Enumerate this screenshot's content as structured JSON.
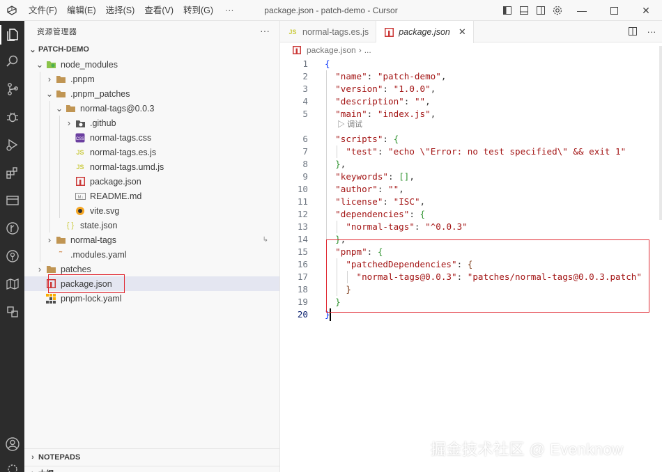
{
  "menu": [
    "文件(F)",
    "编辑(E)",
    "选择(S)",
    "查看(V)",
    "转到(G)"
  ],
  "menu_more": "···",
  "window_title": "package.json - patch-demo - Cursor",
  "sidebar": {
    "header": "资源管理器",
    "more": "···",
    "root": "PATCH-DEMO",
    "tree": [
      {
        "label": "node_modules",
        "depth": 0,
        "kind": "folder-node",
        "open": true
      },
      {
        "label": ".pnpm",
        "depth": 1,
        "kind": "folder",
        "open": false
      },
      {
        "label": ".pnpm_patches",
        "depth": 1,
        "kind": "folder",
        "open": true
      },
      {
        "label": "normal-tags@0.0.3",
        "depth": 2,
        "kind": "folder",
        "open": true
      },
      {
        "label": ".github",
        "depth": 3,
        "kind": "folder-github",
        "open": false
      },
      {
        "label": "normal-tags.css",
        "depth": 3,
        "kind": "css"
      },
      {
        "label": "normal-tags.es.js",
        "depth": 3,
        "kind": "js"
      },
      {
        "label": "normal-tags.umd.js",
        "depth": 3,
        "kind": "js"
      },
      {
        "label": "package.json",
        "depth": 3,
        "kind": "npm"
      },
      {
        "label": "README.md",
        "depth": 3,
        "kind": "md"
      },
      {
        "label": "vite.svg",
        "depth": 3,
        "kind": "svg"
      },
      {
        "label": "state.json",
        "depth": 2,
        "kind": "json"
      },
      {
        "label": "normal-tags",
        "depth": 1,
        "kind": "folder",
        "open": false,
        "badge": "↳"
      },
      {
        "label": ".modules.yaml",
        "depth": 1,
        "kind": "yaml"
      },
      {
        "label": "patches",
        "depth": 0,
        "kind": "folder",
        "open": false
      },
      {
        "label": "package.json",
        "depth": 0,
        "kind": "npm",
        "selected": true
      },
      {
        "label": "pnpm-lock.yaml",
        "depth": 0,
        "kind": "pnpm"
      }
    ],
    "notepads": "NOTEPADS",
    "outline": "大纲"
  },
  "tabs": [
    {
      "label": "normal-tags.es.js",
      "icon": "js",
      "active": false
    },
    {
      "label": "package.json",
      "icon": "npm",
      "active": true,
      "close": "✕"
    }
  ],
  "breadcrumb": {
    "file": "package.json",
    "sep": "›",
    "more": "..."
  },
  "codelens": "调试",
  "code_lines": [
    {
      "n": "1",
      "text": "{"
    },
    {
      "n": "2",
      "text": "  \"name\": \"patch-demo\","
    },
    {
      "n": "3",
      "text": "  \"version\": \"1.0.0\","
    },
    {
      "n": "4",
      "text": "  \"description\": \"\","
    },
    {
      "n": "5",
      "text": "  \"main\": \"index.js\","
    },
    {
      "n": "6",
      "text": "  \"scripts\": {"
    },
    {
      "n": "7",
      "text": "    \"test\": \"echo \\\"Error: no test specified\\\" && exit 1\""
    },
    {
      "n": "8",
      "text": "  },"
    },
    {
      "n": "9",
      "text": "  \"keywords\": [],"
    },
    {
      "n": "10",
      "text": "  \"author\": \"\","
    },
    {
      "n": "11",
      "text": "  \"license\": \"ISC\","
    },
    {
      "n": "12",
      "text": "  \"dependencies\": {"
    },
    {
      "n": "13",
      "text": "    \"normal-tags\": \"^0.0.3\""
    },
    {
      "n": "14",
      "text": "  },"
    },
    {
      "n": "15",
      "text": "  \"pnpm\": {"
    },
    {
      "n": "16",
      "text": "    \"patchedDependencies\": {"
    },
    {
      "n": "17",
      "text": "      \"normal-tags@0.0.3\": \"patches/normal-tags@0.0.3.patch\""
    },
    {
      "n": "18",
      "text": "    }"
    },
    {
      "n": "19",
      "text": "  }"
    },
    {
      "n": "20",
      "text": "}"
    }
  ],
  "watermark": "掘金技术社区 @ Evenknow",
  "colors": {
    "highlight_box": "#e0262f",
    "activity_bar": "#2c2c2c",
    "string": "#a31515"
  }
}
